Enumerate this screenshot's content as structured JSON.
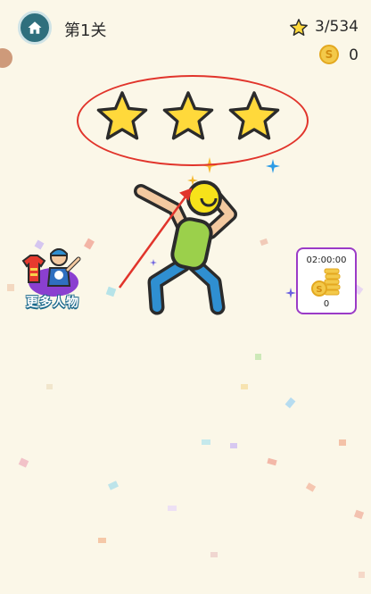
{
  "header": {
    "level_label": "第1关",
    "stars_progress": "3/534",
    "coins": "0",
    "coin_symbol": "S"
  },
  "result": {
    "stars_earned": 3,
    "stars_total": 3
  },
  "more_characters": {
    "label": "更多人物"
  },
  "reward": {
    "timer": "02:00:00",
    "count": "0",
    "coin_symbol": "S"
  },
  "colors": {
    "star_fill": "#ffd93b",
    "star_outline": "#2b2b2b",
    "annotation_red": "#e1342b",
    "home_button": "#2f6f7d",
    "figure_shirt": "#9bd04b",
    "figure_pants": "#2f8fd1",
    "figure_skin": "#f3c9a0",
    "figure_head": "#f7e21a",
    "card_border": "#9b3bc7"
  }
}
